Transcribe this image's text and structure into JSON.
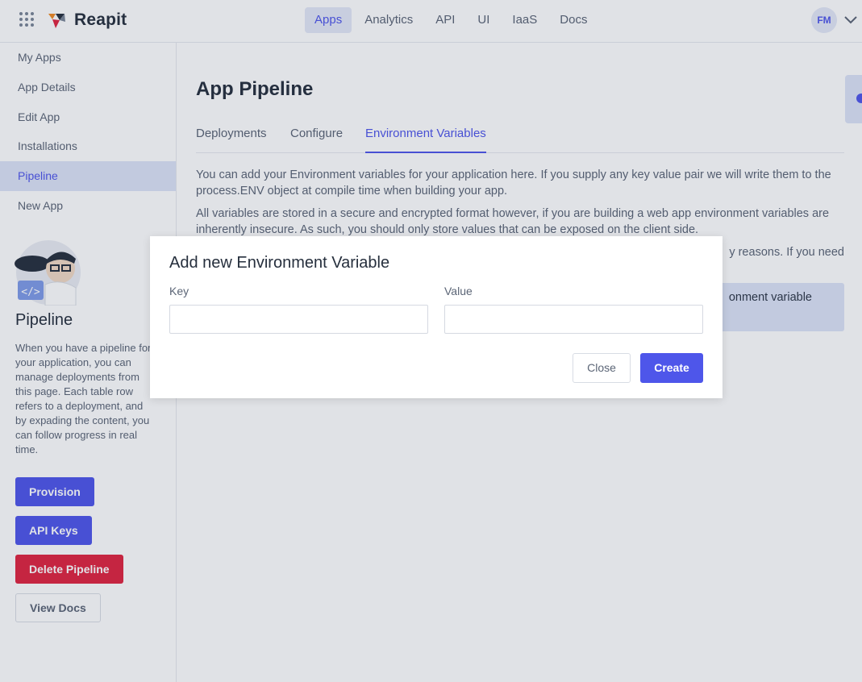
{
  "header": {
    "brand": "Reapit",
    "nav": [
      {
        "label": "Apps",
        "active": true
      },
      {
        "label": "Analytics",
        "active": false
      },
      {
        "label": "API",
        "active": false
      },
      {
        "label": "UI",
        "active": false
      },
      {
        "label": "IaaS",
        "active": false
      },
      {
        "label": "Docs",
        "active": false
      }
    ],
    "user_initials": "FM"
  },
  "sidebar": {
    "items": [
      {
        "label": "My Apps"
      },
      {
        "label": "App Details"
      },
      {
        "label": "Edit App"
      },
      {
        "label": "Installations"
      },
      {
        "label": "Pipeline",
        "active": true
      },
      {
        "label": "New App"
      }
    ],
    "section_title": "Pipeline",
    "description": "When you have a pipeline for your application, you can manage deployments from this page. Each table row refers to a deployment, and by expading the content, you can follow progress in real time.",
    "buttons": {
      "provision": "Provision",
      "api_keys": "API Keys",
      "delete_pipeline": "Delete Pipeline",
      "view_docs": "View Docs"
    }
  },
  "main": {
    "title": "App Pipeline",
    "tabs": [
      {
        "label": "Deployments"
      },
      {
        "label": "Configure"
      },
      {
        "label": "Environment Variables",
        "active": true
      }
    ],
    "paragraphs": [
      "You can add your Environment variables for your application here. If you supply any key value pair we will write them to the process.ENV object at compile time when building your app.",
      "All variables are stored in a secure and encrypted format however, if you are building a web app environment variables are inherently insecure. As such, you should only store values that can be exposed on the client side.",
      "y reasons. If you need"
    ],
    "info_text": "onment variable"
  },
  "modal": {
    "title": "Add new Environment Variable",
    "key_label": "Key",
    "key_value": "",
    "value_label": "Value",
    "value_value": "",
    "close_label": "Close",
    "create_label": "Create"
  },
  "colors": {
    "accent": "#4e56ea",
    "danger": "#e0243f",
    "active_bg": "#dde3f7"
  }
}
